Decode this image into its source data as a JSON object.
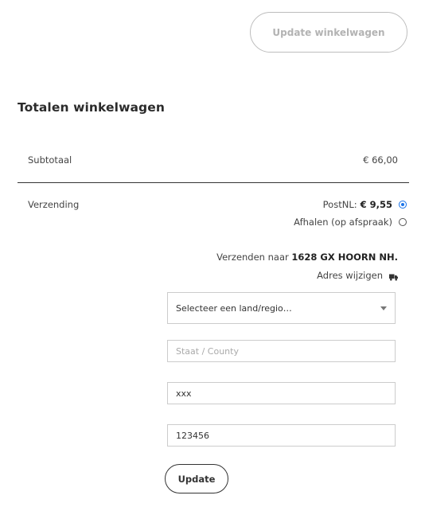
{
  "cart": {
    "update_cart_label": "Update winkelwagen"
  },
  "totals": {
    "title": "Totalen winkelwagen",
    "subtotal_label": "Subtotaal",
    "subtotal_value": "€ 66,00",
    "shipping_label": "Verzending",
    "options": [
      {
        "label": "PostNL:",
        "price": "€ 9,55",
        "selected": true
      },
      {
        "label": "Afhalen (op afspraak)",
        "price": "",
        "selected": false
      }
    ],
    "ship_to_prefix": "Verzenden naar",
    "ship_to_address": "1628 GX HOORN NH.",
    "change_address_label": "Adres wijzigen",
    "change_address_icon": "truck-icon"
  },
  "address_form": {
    "country_selected": "Selecteer een land/regio…",
    "state_placeholder": "Staat / County",
    "state_value": "",
    "city_value": "xxx",
    "postcode_value": "123456",
    "update_label": "Update"
  },
  "colors": {
    "accent": "#1a73e8",
    "text": "#333333",
    "muted_button_text": "#b3b3b3"
  }
}
